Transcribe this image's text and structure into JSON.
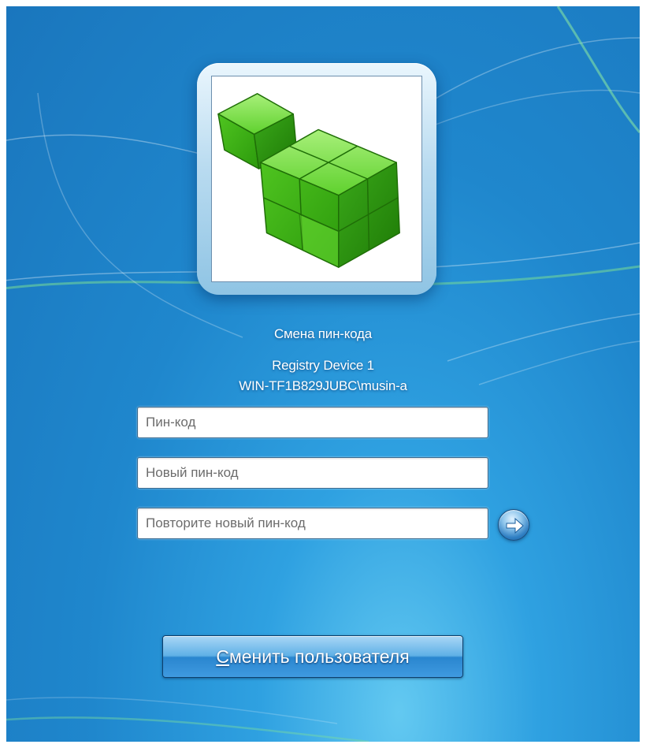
{
  "login": {
    "title": "Смена пин-кода",
    "device_name": "Registry Device 1",
    "account": "WIN-TF1B829JUBC\\musin-a",
    "avatar_icon": "registry-cubes-icon"
  },
  "fields": {
    "pin": {
      "placeholder": "Пин-код",
      "value": ""
    },
    "new_pin": {
      "placeholder": "Новый пин-код",
      "value": ""
    },
    "repeat_pin": {
      "placeholder": "Повторите новый пин-код",
      "value": ""
    }
  },
  "buttons": {
    "submit_icon": "arrow-right-icon",
    "switch_user_mnemonic": "С",
    "switch_user_rest": "менить пользователя"
  },
  "colors": {
    "background": "#1f87cd",
    "cube_green": "#3cb515",
    "button_blue": "#2a86cf"
  }
}
